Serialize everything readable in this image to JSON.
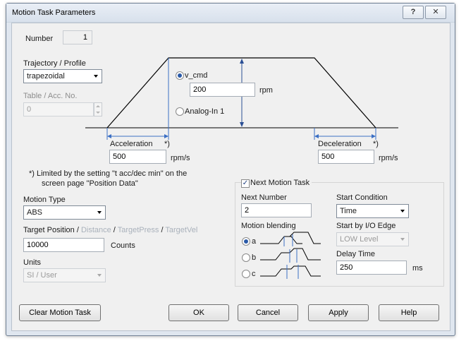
{
  "window": {
    "title": "Motion Task Parameters",
    "help_glyph": "?",
    "close_glyph": "✕"
  },
  "number": {
    "label": "Number",
    "value": "1"
  },
  "trajectory": {
    "label": "Trajectory / Profile",
    "selected": "trapezoidal"
  },
  "table": {
    "label": "Table / Acc. No.",
    "value": "0"
  },
  "diagram": {
    "v_cmd_label": "v_cmd",
    "v_cmd_value": "200",
    "v_cmd_unit": "rpm",
    "analog_label": "Analog-In 1",
    "acceleration_label": "Acceleration",
    "acceleration_note": "*)",
    "acceleration_value": "500",
    "acceleration_unit": "rpm/s",
    "deceleration_label": "Deceleration",
    "deceleration_note": "*)",
    "deceleration_value": "500",
    "deceleration_unit": "rpm/s"
  },
  "footnote": {
    "line1": "*)  Limited by the setting \"t acc/dec min\" on the",
    "line2": "screen page \"Position Data\""
  },
  "motion_type": {
    "label": "Motion Type",
    "selected": "ABS"
  },
  "target": {
    "label_main": "Target Position",
    "label_sep1": " / ",
    "label_distance": "Distance",
    "label_sep2": " / ",
    "label_press": "TargetPress",
    "label_sep3": " / ",
    "label_vel": "TargetVel",
    "value": "10000",
    "unit": "Counts"
  },
  "units": {
    "label": "Units",
    "selected": "SI / User"
  },
  "next_task": {
    "label": "Next Motion Task",
    "checked": true,
    "next_number_label": "Next Number",
    "next_number_value": "2",
    "blending_label": "Motion blending",
    "blend_options": [
      "a",
      "b",
      "c"
    ],
    "start_condition_label": "Start Condition",
    "start_condition_value": "Time",
    "start_edge_label": "Start by I/O Edge",
    "start_edge_value": "LOW Level",
    "delay_label": "Delay Time",
    "delay_value": "250",
    "delay_unit": "ms"
  },
  "buttons": {
    "clear": "Clear Motion Task",
    "ok": "OK",
    "cancel": "Cancel",
    "apply": "Apply",
    "help": "Help"
  }
}
